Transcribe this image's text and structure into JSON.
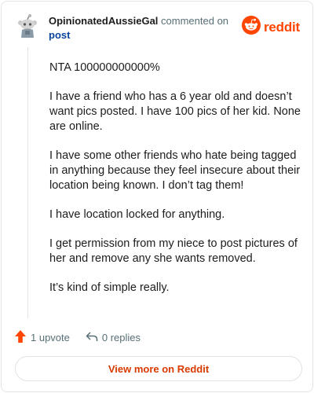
{
  "header": {
    "author": "OpinionatedAussieGal",
    "verb": "commented on",
    "post_link": "post",
    "brand_name": "reddit",
    "brand_color": "#ff4500",
    "avatar_icon": "snoo-avatar-icon"
  },
  "comment": {
    "paragraphs": [
      "NTA 100000000000%",
      "I have a friend who has a 6 year old and doesn’t want pics posted. I have 100 pics of her kid. None are online.",
      "I have some other friends who hate being tagged in anything because they feel insecure about their location being known. I don’t tag them!",
      "I have location locked for anything.",
      "I get permission from my niece to post pictures of her and remove any she wants removed.",
      "It’s kind of simple really."
    ]
  },
  "actions": {
    "upvotes": "1 upvote",
    "replies": "0 replies",
    "upvote_icon": "upvote-arrow-icon",
    "reply_icon": "reply-icon",
    "upvote_color": "#ff4500"
  },
  "footer": {
    "view_more": "View more on Reddit",
    "view_more_color": "#d93a00"
  }
}
